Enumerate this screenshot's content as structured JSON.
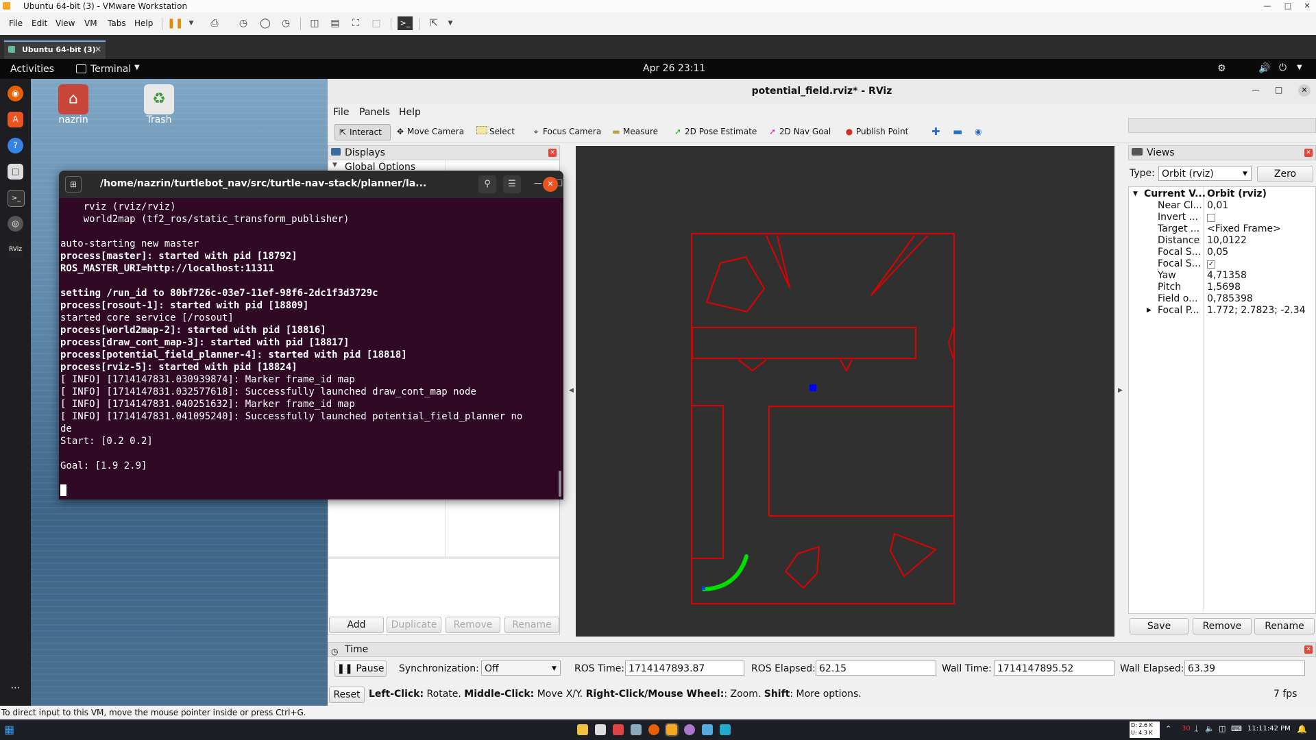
{
  "vmware": {
    "title": "Ubuntu 64-bit (3) - VMware Workstation",
    "menu": [
      "File",
      "Edit",
      "View",
      "VM",
      "Tabs",
      "Help"
    ],
    "tab_label": "Ubuntu 64-bit (3)",
    "status_hint": "To direct input to this VM, move the mouse pointer inside or press Ctrl+G."
  },
  "gnome": {
    "activities": "Activities",
    "app_menu": "Terminal",
    "clock": "Apr 26  23:11"
  },
  "desktop": {
    "icons": [
      {
        "label": "nazrin",
        "icon": "home-folder-icon"
      },
      {
        "label": "Trash",
        "icon": "trash-icon"
      }
    ]
  },
  "rviz": {
    "window_title": "potential_field.rviz* - RViz",
    "menu": [
      "File",
      "Panels",
      "Help"
    ],
    "toolbar": {
      "interact": "Interact",
      "move_camera": "Move Camera",
      "select": "Select",
      "focus_camera": "Focus Camera",
      "measure": "Measure",
      "pose_estimate": "2D Pose Estimate",
      "nav_goal": "2D Nav Goal",
      "publish_point": "Publish Point"
    },
    "displays": {
      "title": "Displays",
      "partial_item": "Global Options",
      "buttons": [
        "Add",
        "Duplicate",
        "Remove",
        "Rename"
      ]
    },
    "views": {
      "title": "Views",
      "type_label": "Type:",
      "type_value": "Orbit (rviz)",
      "zero": "Zero",
      "header_name": "Current V...",
      "header_value": "Orbit (rviz)",
      "rows": [
        {
          "name": "Near Cl...",
          "value": "0,01"
        },
        {
          "name": "Invert ...",
          "value": "",
          "checkbox": false
        },
        {
          "name": "Target ...",
          "value": "<Fixed Frame>"
        },
        {
          "name": "Distance",
          "value": "10,0122"
        },
        {
          "name": "Focal S...",
          "value": "0,05"
        },
        {
          "name": "Focal S...",
          "value": "",
          "checkbox": true
        },
        {
          "name": "Yaw",
          "value": "4,71358"
        },
        {
          "name": "Pitch",
          "value": "1,5698"
        },
        {
          "name": "Field o...",
          "value": "0,785398"
        },
        {
          "name": "Focal P...",
          "value": "1.772; 2.7823; -2.34"
        }
      ],
      "buttons": [
        "Save",
        "Remove",
        "Rename"
      ]
    },
    "time": {
      "title": "Time",
      "pause": "Pause",
      "sync_label": "Synchronization:",
      "sync_value": "Off",
      "ros_time_label": "ROS Time:",
      "ros_time": "1714147893.87",
      "ros_elapsed_label": "ROS Elapsed:",
      "ros_elapsed": "62.15",
      "wall_time_label": "Wall Time:",
      "wall_time": "1714147895.52",
      "wall_elapsed_label": "Wall Elapsed:",
      "wall_elapsed": "63.39"
    },
    "status": {
      "reset": "Reset",
      "k1": "Left-Click:",
      "t1": " Rotate. ",
      "k2": "Middle-Click:",
      "t2": " Move X/Y. ",
      "k3": "Right-Click/Mouse Wheel:",
      "t3": ": Zoom. ",
      "k4": "Shift",
      "t4": ": More options.",
      "fps": "7 fps"
    }
  },
  "terminal": {
    "title": "/home/nazrin/turtlebot_nav/src/turtle-nav-stack/planner/la...",
    "lines": [
      {
        "text": "    rviz (rviz/rviz)",
        "bold": false
      },
      {
        "text": "    world2map (tf2_ros/static_transform_publisher)",
        "bold": false
      },
      {
        "text": "",
        "bold": false
      },
      {
        "text": "auto-starting new master",
        "bold": false
      },
      {
        "text": "process[master]: started with pid [18792]",
        "bold": true
      },
      {
        "text": "ROS_MASTER_URI=http://localhost:11311",
        "bold": true
      },
      {
        "text": "",
        "bold": false
      },
      {
        "text": "setting /run_id to 80bf726c-03e7-11ef-98f6-2dc1f3d3729c",
        "bold": true
      },
      {
        "text": "process[rosout-1]: started with pid [18809]",
        "bold": true
      },
      {
        "text": "started core service [/rosout]",
        "bold": false
      },
      {
        "text": "process[world2map-2]: started with pid [18816]",
        "bold": true
      },
      {
        "text": "process[draw_cont_map-3]: started with pid [18817]",
        "bold": true
      },
      {
        "text": "process[potential_field_planner-4]: started with pid [18818]",
        "bold": true
      },
      {
        "text": "process[rviz-5]: started with pid [18824]",
        "bold": true
      },
      {
        "text": "[ INFO] [1714147831.030939874]: Marker frame_id map",
        "bold": false
      },
      {
        "text": "[ INFO] [1714147831.032577618]: Successfully launched draw_cont_map node",
        "bold": false
      },
      {
        "text": "[ INFO] [1714147831.040251632]: Marker frame_id map",
        "bold": false
      },
      {
        "text": "[ INFO] [1714147831.041095240]: Successfully launched potential_field_planner no",
        "bold": false
      },
      {
        "text": "de",
        "bold": false
      },
      {
        "text": "Start: [0.2 0.2]",
        "bold": false
      },
      {
        "text": "",
        "bold": false
      },
      {
        "text": "Goal: [1.9 2.9]",
        "bold": false
      }
    ]
  },
  "windows": {
    "tray_speed_down": "D: 2.6 K",
    "tray_speed_up": "U: 4.3 K",
    "tray_temp": "30",
    "clock": "11:11:42 PM"
  },
  "colors": {
    "terminal_bg": "#300a24",
    "map_walls": "#e00000",
    "path": "#00e000",
    "goal_marker": "#0000ff",
    "viewport_bg": "#303030"
  }
}
